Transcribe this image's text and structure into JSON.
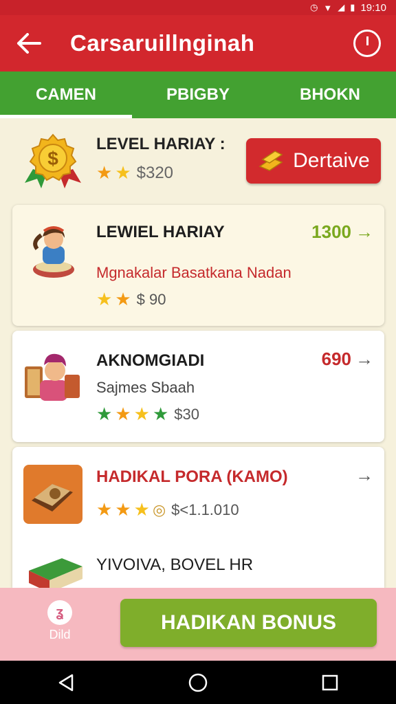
{
  "statusbar": {
    "time": "19:10",
    "icons": [
      "alarm-icon",
      "wifi-icon",
      "signal-icon",
      "battery-icon"
    ]
  },
  "appbar": {
    "title": "Carsaruillnginah"
  },
  "tabs": [
    {
      "label": "CAMEN",
      "active": true
    },
    {
      "label": "PBIGBY",
      "active": false
    },
    {
      "label": "BHOKN",
      "active": false
    }
  ],
  "level_header": {
    "title": "LEVEL HARIAY :",
    "price": "$320",
    "stars": 2,
    "button_label": "Dertaive"
  },
  "cards": [
    {
      "title": "LEWIEL HARIAY",
      "subtitle": "Mgnakalar Basatkana Nadan",
      "price": "1300",
      "stars": 2,
      "star_value": "$ 90",
      "price_color": "#7aa81e"
    },
    {
      "title": "AKNOMGIADI",
      "subtitle": "Sajmes Sbaah",
      "price": "690",
      "stars": 4,
      "star_value": "$30",
      "price_color": "#c52a2c"
    },
    {
      "title": "HADIKAL PORA (KAMO)",
      "subtitle": "",
      "price": "",
      "stars": 3,
      "star_value": "$<1.1.010",
      "price_color": "#555555"
    },
    {
      "title": "YIVOIVA, BOVEL HR"
    }
  ],
  "bottom": {
    "left_label": "Dild",
    "button_label": "HADIKAN BONUS"
  },
  "colors": {
    "red": "#d2272d",
    "green": "#43a131",
    "accent_green": "#7fae2b",
    "pink": "#f6b9c0"
  }
}
